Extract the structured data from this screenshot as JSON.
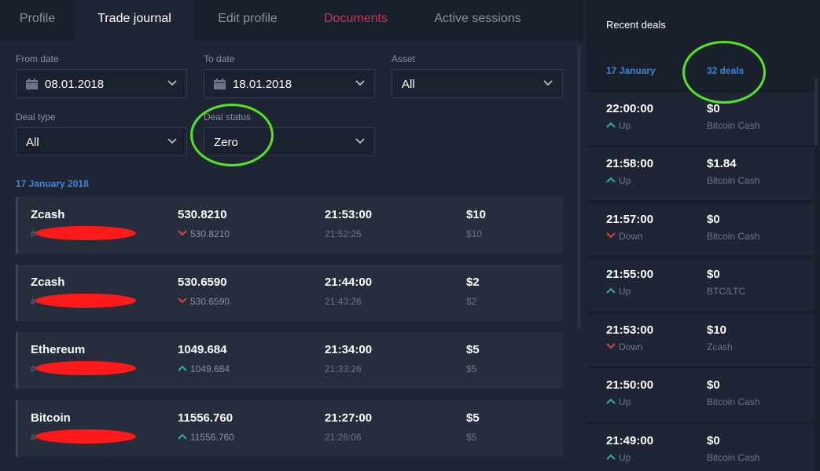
{
  "tabs": [
    {
      "label": "Profile"
    },
    {
      "label": "Trade journal"
    },
    {
      "label": "Edit profile"
    },
    {
      "label": "Documents"
    },
    {
      "label": "Active sessions"
    }
  ],
  "filters": {
    "from_date": {
      "label": "From date",
      "value": "08.01.2018"
    },
    "to_date": {
      "label": "To date",
      "value": "18.01.2018"
    },
    "asset": {
      "label": "Asset",
      "value": "All"
    },
    "deal_type": {
      "label": "Deal type",
      "value": "All"
    },
    "deal_status": {
      "label": "Deal status",
      "value": "Zero"
    }
  },
  "journal": {
    "date_header": "17 January 2018",
    "rows": [
      {
        "asset": "Zcash",
        "id_prefix": "#",
        "open_price": "530.8210",
        "close_price": "530.8210",
        "direction": "down",
        "close_time": "21:53:00",
        "open_time": "21:52:25",
        "amount": "$10",
        "payout": "$10"
      },
      {
        "asset": "Zcash",
        "id_prefix": "#",
        "open_price": "530.6590",
        "close_price": "530.6590",
        "direction": "down",
        "close_time": "21:44:00",
        "open_time": "21:43:26",
        "amount": "$2",
        "payout": "$2"
      },
      {
        "asset": "Ethereum",
        "id_prefix": "#",
        "open_price": "1049.684",
        "close_price": "1049.684",
        "direction": "up",
        "close_time": "21:34:00",
        "open_time": "21:33:26",
        "amount": "$5",
        "payout": "$5"
      },
      {
        "asset": "Bitcoin",
        "id_prefix": "#",
        "open_price": "11556.760",
        "close_price": "11556.760",
        "direction": "up",
        "close_time": "21:27:00",
        "open_time": "21:26:06",
        "amount": "$5",
        "payout": "$5"
      }
    ]
  },
  "recent": {
    "title": "Recent deals",
    "date": "17 January",
    "count": "32 deals",
    "deals": [
      {
        "time": "22:00:00",
        "direction": "Up",
        "amount": "$0",
        "asset": "Bitcoin Cash"
      },
      {
        "time": "21:58:00",
        "direction": "Up",
        "amount": "$1.84",
        "asset": "Bitcoin Cash"
      },
      {
        "time": "21:57:00",
        "direction": "Down",
        "amount": "$0",
        "asset": "Bitcoin Cash"
      },
      {
        "time": "21:55:00",
        "direction": "Up",
        "amount": "$0",
        "asset": "BTC/LTC"
      },
      {
        "time": "21:53:00",
        "direction": "Down",
        "amount": "$10",
        "asset": "Zcash"
      },
      {
        "time": "21:50:00",
        "direction": "Up",
        "amount": "$0",
        "asset": "Bitcoin Cash"
      },
      {
        "time": "21:49:00",
        "direction": "Up",
        "amount": "$0",
        "asset": "Bitcoin Cash"
      }
    ]
  },
  "colors": {
    "up": "#2bb58f",
    "down": "#d9443f",
    "accent": "#3a86d8",
    "highlight": "#55e51c",
    "redaction": "#ff1a1a"
  }
}
